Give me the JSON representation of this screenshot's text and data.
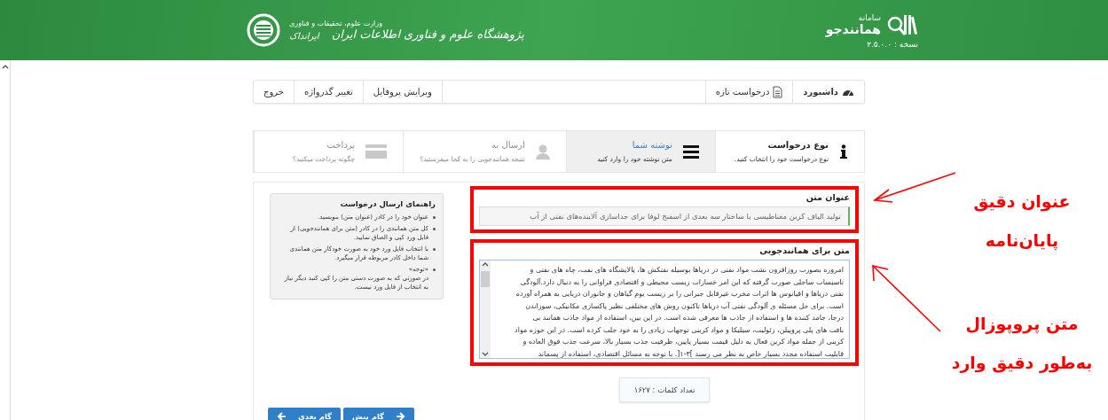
{
  "header": {
    "system_label": "سامانه",
    "system_name": "همانندجو",
    "version": "نسخه : ۲.۵.۰.۰",
    "ministry": "وزارت علوم، تحقیقات و فناوری",
    "institute": "پژوهشگاه علوم و فناوری اطلاعات ایران",
    "brand": "ایرانداک"
  },
  "nav": {
    "right": [
      {
        "label": "داشبورد"
      },
      {
        "label": "درخواست تازه"
      }
    ],
    "left": [
      "ویرایش پروفایل",
      "تغییر گذرواژه",
      "خروج"
    ]
  },
  "steps": [
    {
      "title": "نوع درخواست",
      "subtitle": "نوع درخواست خود را انتخاب کنید.",
      "selected": false,
      "disabled": false
    },
    {
      "title": "نوشته شما",
      "subtitle": "متن نوشته خود را وارد کنید",
      "selected": true,
      "disabled": false
    },
    {
      "title": "ارسال به",
      "subtitle": "نتیجه همانندجویی را به کجا میفرستید؟",
      "selected": false,
      "disabled": true
    },
    {
      "title": "پرداخت",
      "subtitle": "چگونه پرداخت میکنید؟",
      "selected": false,
      "disabled": true
    }
  ],
  "form": {
    "title_label": "عنوان متن",
    "title_value": "تولید الیاف کربن مغناطیسی با ساختار سه بعدی از اسفنج لوفا برای جداسازی آلاینده‌های نفتی از آب",
    "text_label": "متن برای همانندجویی",
    "text_lines": [
      "امروزه بصورت روزافزون نشت مواد نفتی در دریاها بوسیله نفتکش ها، پالایشگاه های نفت، چاه های نفتی و",
      "تاسیسات ساحلی صورت گرفته که این امر خسارات زیست محیطی و اقتصادی فراوانی را به دنبال دارد.آلودگی",
      "نفتی دریاها و اقیانوس ها اثرات مخرب غیرقابل جبرانی را بر زیست بوم گیاهان و جانوران دریایی به همراه آورده",
      "است. برای حل مسئله ی آلودگی نفتی آب دریاها تاکنون روش های مختلفی نظیر پاکسازی مکانیکی، سوزاندن",
      "درجا، جامد کننده ها و استفاده از جاذب ها معرفی شده است. در این بین، استفاده از مواد جاذب همانند بی",
      "بافت های پلی پروپیلن، زئولیت، سیلیکا و مواد کربنی توجهات زیادی را به خود جلب کرده است. در این حوزه مواد",
      "کربنی از جمله مواد کربن فعال به دلیل قیمت بسیار پایین، ظرفیت جذب بسیار بالا، سرعت جذب فوق العاده و",
      "قابلیت استفاده مجدد بسیار خاص به نظر می رسند ]۳-۱[. با توجه به مسائل اقتصادی، استفاده از پسماند"
    ],
    "word_count": "تعداد کلمات : ۱۶۲۷"
  },
  "guide": {
    "title": "راهنمای ارسال درخواست",
    "items": [
      {
        "text": "عنوان خود را در کادر (عنوان متن) بنویسید."
      },
      {
        "text": "کل متن همانندی را در کادر (متن برای همانندجویی) از فایل ورد کپی و الصاق نمایید."
      },
      {
        "text": "با انتخاب فایل ورد خود به صورت خودکار متن همانندی شما داخل کادر مربوطه قرار میگیرد."
      },
      {
        "heading": "«توجه»",
        "text": "در صورتی که به صورت دستی متن را کپی کنید دیگر نیاز به انتخاب از فایل ورد نیست."
      }
    ]
  },
  "buttons": [
    {
      "label": "گام پیش"
    },
    {
      "label": "گام بعدی"
    }
  ],
  "annotations": [
    {
      "lines": [
        "عنوان دقیق",
        "پایان‌نامه"
      ]
    },
    {
      "lines": [
        "متن پروپوزال",
        "به‌طور دقیق وارد"
      ]
    }
  ]
}
